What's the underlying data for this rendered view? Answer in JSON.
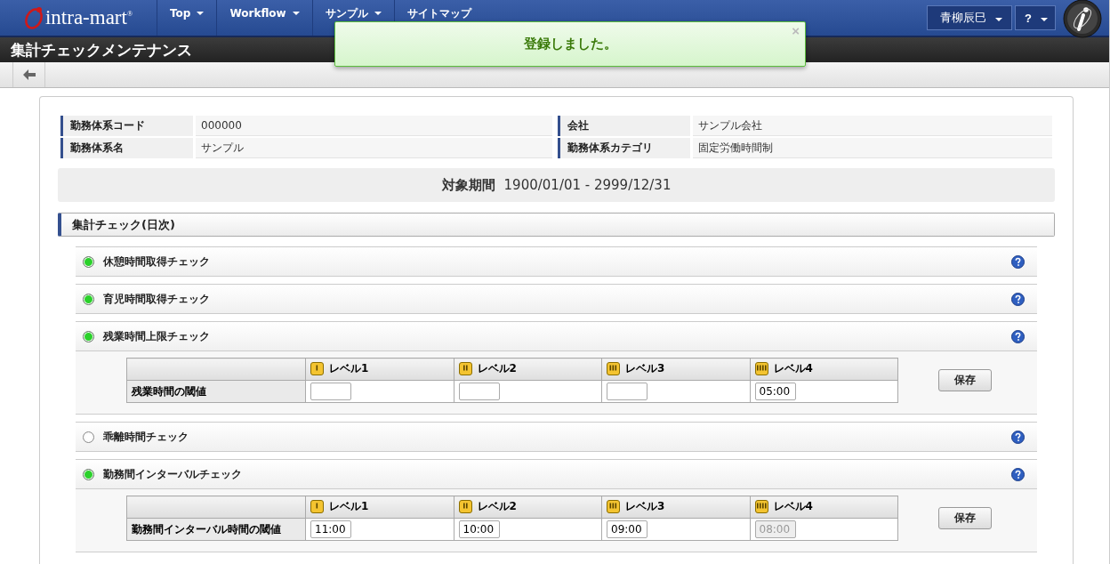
{
  "header": {
    "logo": "intra-mart$^{®}$",
    "nav": [
      {
        "label": "Top",
        "dropdown": true
      },
      {
        "label": "Workflow",
        "dropdown": true
      },
      {
        "label": "サンプル",
        "dropdown": true
      },
      {
        "label": "サイトマップ",
        "dropdown": false
      }
    ],
    "user_menu": "青柳辰巳",
    "help_menu": "?"
  },
  "page_title": "集計チェックメンテナンス",
  "toast": {
    "message": "登録しました。",
    "close": "×"
  },
  "info": [
    {
      "label": "勤務体系コード",
      "value": "000000"
    },
    {
      "label": "会社",
      "value": "サンプル会社"
    },
    {
      "label": "勤務体系名",
      "value": "サンプル"
    },
    {
      "label": "勤務体系カテゴリ",
      "value": "固定労働時間制"
    }
  ],
  "period": {
    "label": "対象期間",
    "value": "1900/01/01 - 2999/12/31"
  },
  "section": "集計チェック(日次)",
  "checks": [
    {
      "name": "休憩時間取得チェック",
      "on": true
    },
    {
      "name": "育児時間取得チェック",
      "on": true
    },
    {
      "name": "残業時間上限チェック",
      "on": true,
      "threshold": {
        "row_label": "残業時間の閾値",
        "levels": [
          {
            "label": "レベル1",
            "disabled": false
          },
          {
            "label": "レベル2",
            "disabled": false
          },
          {
            "label": "レベル3",
            "disabled": false
          },
          {
            "label": "レベル4",
            "value": "05:00",
            "disabled": false
          }
        ],
        "save": "保存"
      }
    },
    {
      "name": "乖離時間チェック",
      "on": false
    },
    {
      "name": "勤務間インターバルチェック",
      "on": true,
      "threshold": {
        "row_label": "勤務間インターバル時間の閾値",
        "levels": [
          {
            "label": "レベル1",
            "value": "11:00",
            "disabled": false
          },
          {
            "label": "レベル2",
            "value": "10:00",
            "disabled": false
          },
          {
            "label": "レベル3",
            "value": "09:00",
            "disabled": false
          },
          {
            "label": "レベル4",
            "value": "08:00",
            "disabled": true
          }
        ],
        "save": "保存"
      }
    }
  ]
}
